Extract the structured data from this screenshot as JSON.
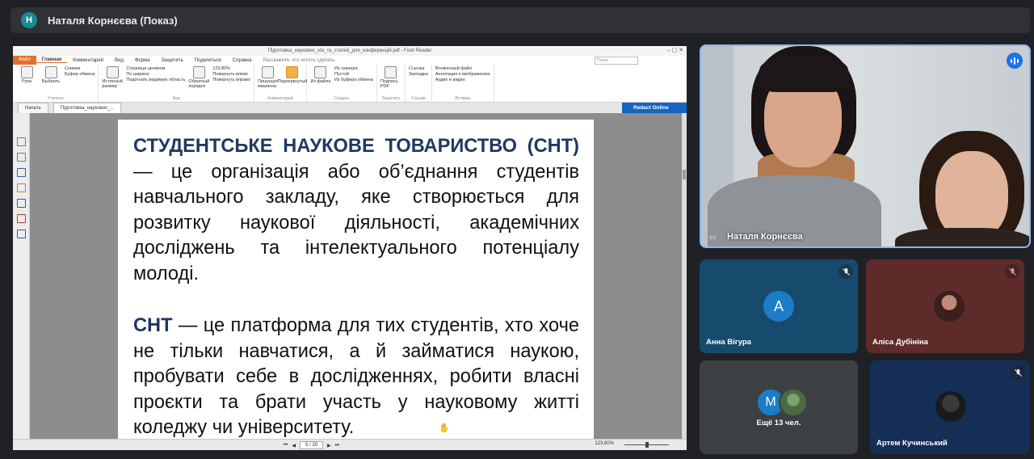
{
  "meet": {
    "presenter_initial": "Н",
    "presentation_title": "Наталя Корнєєва (Показ)"
  },
  "foxit": {
    "window_title": "Підготовка_наукових_sta_та_статей_для_конференцій.pdf - Foxit Reader",
    "menu_tabs": [
      "Файл",
      "Главная",
      "Комментарий",
      "Вид",
      "Форма",
      "Защитить",
      "Поделиться",
      "Справка"
    ],
    "tell_me": "Расскажите, что хотите сделать",
    "search_placeholder": "Поиск",
    "ribbon": {
      "tools_hand": "Рука",
      "tools_select": "Выбрать",
      "snapshot": "Снимок",
      "clipboard": "Буфер обмена",
      "tools_group": "Утилиты",
      "actual_size": "Истинный размер",
      "fit_page": "Страница целиком",
      "fit_width": "По ширине",
      "fit_visible": "Подогнать видимую область",
      "reflow": "Обратный порядок",
      "zoom_value": "123,80%",
      "rotate_left": "Повернуть влево",
      "rotate_right": "Повернуть вправо",
      "view_group": "Вид",
      "typewriter": "Пишущая машинка",
      "highlight": "Подчеркнутый",
      "comment_group": "Комментарий",
      "from_file": "Из файла",
      "from_scanner": "Из сканера",
      "blank": "Пустой",
      "from_clipboard": "Из буфера обмена",
      "create_group": "Создать",
      "sign_pdf": "Подпись PDF",
      "protect_group": "Защитить",
      "link": "Ссылка",
      "bookmark": "Закладка",
      "links_group": "Ссылки",
      "attach_file": "Вложенный файл",
      "image_annotation": "Аннотация к изображению",
      "audio_video": "Аудио и видео",
      "insert_group": "Вставка"
    },
    "doc_tabs": [
      "Начать",
      "Підготовка_наукових_..."
    ],
    "redact_label": "Redact Online",
    "page_text": {
      "p1_term": "СТУДЕНТСЬКЕ НАУКОВЕ ТОВАРИСТВО (СНТ)",
      "p1_rest": " — це організація або об’єднання студентів навчального закладу, яке створюється для розвитку наукової діяльності, академічних досліджень та інтелектуального потенціалу молоді.",
      "p2_term": "СНТ",
      "p2_rest": " — це платформа для тих студентів, хто хоче не тільки навчатися, а й займатися наукою, пробувати себе в дослідженнях, робити власні проєкти та брати участь у науковому житті коледжу чи університету."
    },
    "status": {
      "page_indicator": "5 / 30",
      "zoom": "123,80%"
    }
  },
  "participants": {
    "main_name": "Наталя Корнєєва",
    "tiles": [
      {
        "name": "Анна Вігура",
        "initial": "А"
      },
      {
        "name": "Аліса Дубініна"
      },
      {
        "more_text": "Ещё 13 чел.",
        "initial": "М"
      },
      {
        "name": "Артем Кучинський"
      }
    ]
  },
  "colors": {
    "meet_bg": "#202124",
    "accent_blue": "#1a73e8",
    "foxit_orange": "#e46f26",
    "heading_navy": "#1f3864"
  }
}
